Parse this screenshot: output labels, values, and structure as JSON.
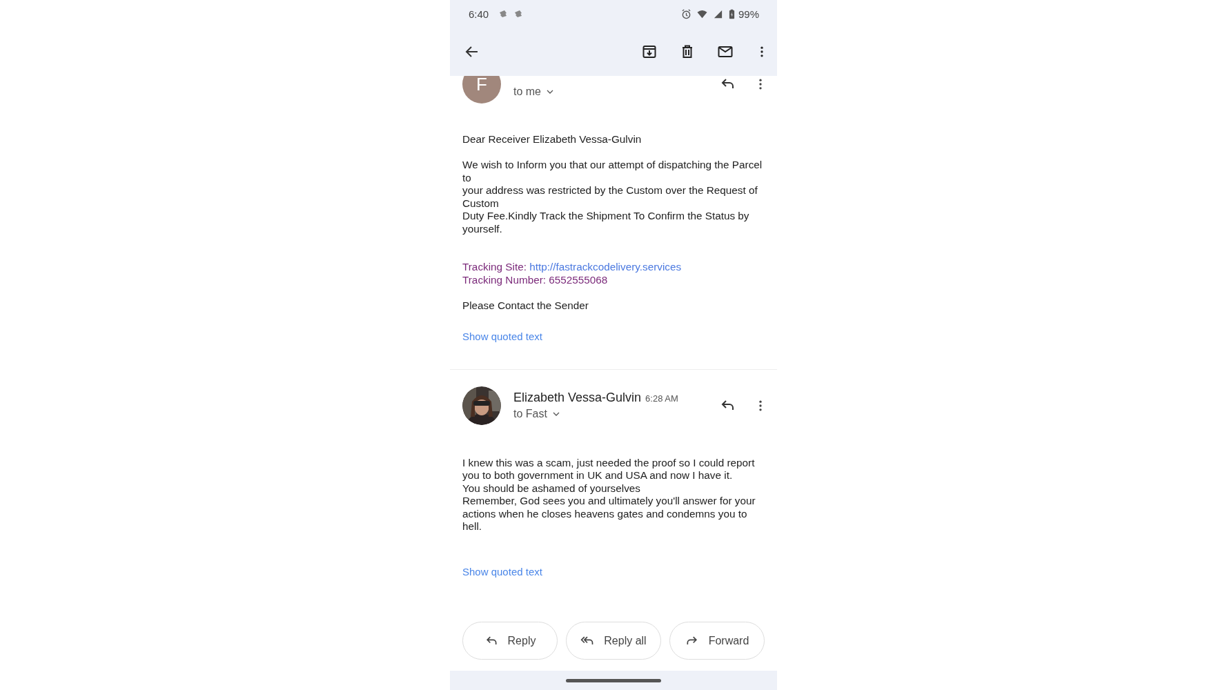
{
  "status_bar": {
    "time": "6:40",
    "battery": "99%"
  },
  "messages": [
    {
      "avatar": {
        "kind": "letter",
        "letter": "F",
        "color": "#a1877c"
      },
      "recipient": "to me",
      "body": [
        {
          "kind": "text",
          "text": "Dear Receiver Elizabeth Vessa-Gulvin"
        },
        {
          "kind": "text",
          "text": "We wish to Inform you that our attempt of dispatching the Parcel to\nyour address was restricted by the Custom over the Request of Custom\nDuty Fee.Kindly Track the Shipment To Confirm the Status by yourself."
        },
        {
          "kind": "tracking",
          "site_label": "Tracking Site:",
          "site_url": "http://fastrackcodelivery.services",
          "number": "Tracking Number: 6552555068"
        },
        {
          "kind": "text",
          "text": "Please Contact the Sender"
        }
      ],
      "show_quoted": "Show quoted text"
    },
    {
      "avatar": {
        "kind": "picture"
      },
      "sender": "Elizabeth Vessa-Gulvin",
      "time": "6:28 AM",
      "recipient": "to Fast",
      "body": [
        {
          "kind": "text",
          "text": "I knew this was a scam, just needed the proof so I could report you to both government in UK and USA and now I have it.\nYou should be ashamed of yourselves\nRemember, God sees you and ultimately you'll answer for your actions when he closes heavens gates and condemns you to hell."
        }
      ],
      "show_quoted": "Show quoted text"
    }
  ],
  "actions": [
    {
      "label": "Reply",
      "kind": "reply"
    },
    {
      "label": "Reply all",
      "kind": "reply_all"
    },
    {
      "label": "Forward",
      "kind": "forward"
    }
  ]
}
